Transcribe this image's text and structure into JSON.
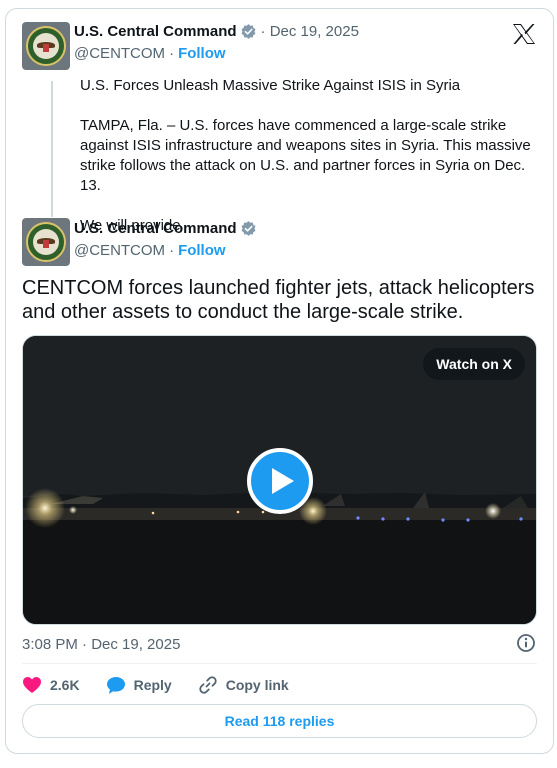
{
  "quoted_post": {
    "author_name": "U.S. Central Command",
    "date": "· Dec 19, 2025",
    "handle": "@CENTCOM",
    "separator": "·",
    "follow_label": "Follow",
    "text_paragraphs": [
      "U.S. Forces Unleash Massive Strike Against ISIS in Syria",
      "TAMPA, Fla. – U.S. forces have commenced a large-scale strike against ISIS infrastructure and weapons sites in Syria. This massive strike follows the attack on U.S. and partner forces in Syria on Dec. 13.",
      "We will provide"
    ]
  },
  "main_post": {
    "author_name": "U.S. Central Command",
    "handle": "@CENTCOM",
    "separator": "·",
    "follow_label": "Follow",
    "text": "CENTCOM forces launched fighter jets, attack helicopters and other assets to conduct the large-scale strike.",
    "video": {
      "watch_label": "Watch on X"
    },
    "timestamp": "3:08 PM · Dec 19, 2025",
    "actions": {
      "like_count": "2.6K",
      "reply_label": "Reply",
      "copy_link_label": "Copy link"
    },
    "read_replies_label": "Read 118 replies"
  },
  "colors": {
    "accent": "#1d9bf0",
    "like": "#f91880",
    "secondary_text": "#536471",
    "border": "#cfd9de"
  },
  "icons": [
    "x-logo-icon",
    "verified-badge-icon",
    "play-icon",
    "info-icon",
    "heart-icon",
    "reply-bubble-icon",
    "link-icon"
  ]
}
